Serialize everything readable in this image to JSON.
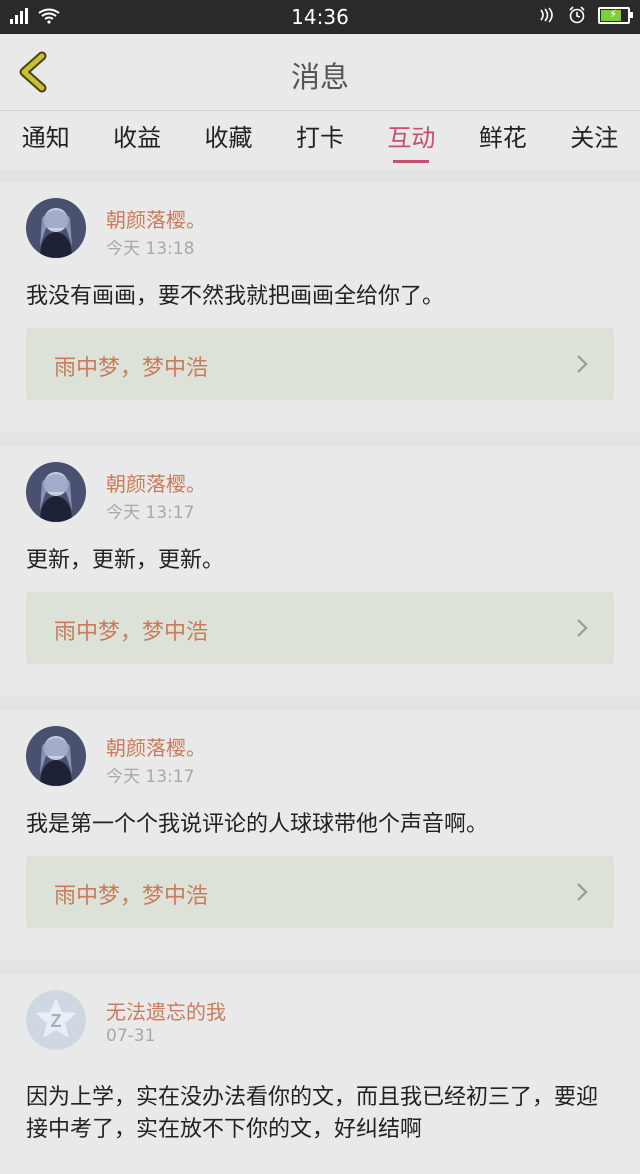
{
  "statusbar": {
    "time": "14:36"
  },
  "header": {
    "title": "消息"
  },
  "tabs": [
    "通知",
    "收益",
    "收藏",
    "打卡",
    "互动",
    "鲜花",
    "关注"
  ],
  "active_tab": "互动",
  "messages": [
    {
      "author": "朝颜落樱。",
      "date": "今天 13:18",
      "content": "我没有画画，要不然我就把画画全给你了。",
      "ref": "雨中梦，梦中浩"
    },
    {
      "author": "朝颜落樱。",
      "date": "今天 13:17",
      "content": "更新，更新，更新。",
      "ref": "雨中梦，梦中浩"
    },
    {
      "author": "朝颜落樱。",
      "date": "今天 13:17",
      "content": "我是第一个个我说评论的人球球带他个声音啊。",
      "ref": "雨中梦，梦中浩"
    },
    {
      "author": "无法遗忘的我",
      "date": "07-31",
      "content": "因为上学，实在没办法看你的文，而且我已经初三了，要迎接中考了，实在放不下你的文，好纠结啊"
    }
  ],
  "colors": {
    "accent": "#c4506c",
    "author": "#c97b5a"
  }
}
